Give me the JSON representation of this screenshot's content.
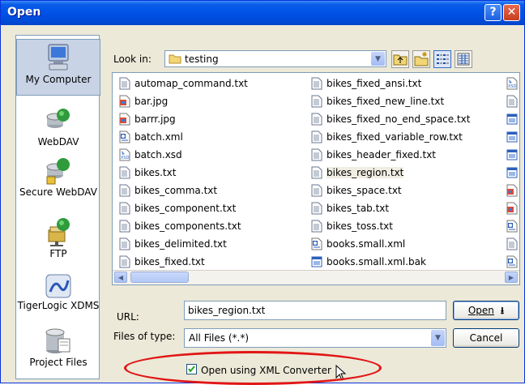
{
  "window": {
    "title": "Open"
  },
  "places": [
    {
      "label": "My Computer",
      "icon": "my-computer-icon",
      "selected": true
    },
    {
      "label": "WebDAV",
      "icon": "webdav-icon"
    },
    {
      "label": "Secure WebDAV",
      "icon": "secure-webdav-icon"
    },
    {
      "label": "FTP",
      "icon": "ftp-icon"
    },
    {
      "label": "TigerLogic XDMS",
      "icon": "tigerlogic-xdms-icon"
    },
    {
      "label": "Project Files",
      "icon": "project-files-icon"
    }
  ],
  "look_in": {
    "label": "Look in:",
    "value": "testing"
  },
  "files": {
    "col1": [
      {
        "name": "automap_command.txt",
        "type": "txt"
      },
      {
        "name": "bar.jpg",
        "type": "jpg"
      },
      {
        "name": "barrr.jpg",
        "type": "jpg"
      },
      {
        "name": "batch.xml",
        "type": "xml"
      },
      {
        "name": "batch.xsd",
        "type": "xsd"
      },
      {
        "name": "bikes.txt",
        "type": "txt"
      },
      {
        "name": "bikes_comma.txt",
        "type": "txt"
      },
      {
        "name": "bikes_component.txt",
        "type": "txt"
      },
      {
        "name": "bikes_components.txt",
        "type": "txt"
      },
      {
        "name": "bikes_delimited.txt",
        "type": "txt"
      },
      {
        "name": "bikes_fixed.txt",
        "type": "txt"
      }
    ],
    "col2": [
      {
        "name": "bikes_fixed_ansi.txt",
        "type": "txt"
      },
      {
        "name": "bikes_fixed_new_line.txt",
        "type": "txt"
      },
      {
        "name": "bikes_fixed_no_end_space.txt",
        "type": "txt"
      },
      {
        "name": "bikes_fixed_variable_row.txt",
        "type": "txt"
      },
      {
        "name": "bikes_header_fixed.txt",
        "type": "txt"
      },
      {
        "name": "bikes_region.txt",
        "type": "txt",
        "highlighted": true
      },
      {
        "name": "bikes_space.txt",
        "type": "txt"
      },
      {
        "name": "bikes_tab.txt",
        "type": "txt"
      },
      {
        "name": "bikes_toss.txt",
        "type": "txt"
      },
      {
        "name": "books.small.xml",
        "type": "xml"
      },
      {
        "name": "books.small.xml.bak",
        "type": "bak"
      }
    ]
  },
  "url": {
    "label": "URL:",
    "value": "bikes_region.txt"
  },
  "files_of_type": {
    "label": "Files of type:",
    "value": "All Files (*.*)"
  },
  "buttons": {
    "open": "Open",
    "cancel": "Cancel"
  },
  "checkbox": {
    "label": "Open using XML Converter",
    "checked": true
  },
  "colors": {
    "titlebar": "#0052e6",
    "highlight_ellipse": "#e21515",
    "dialog_bg": "#ece9d8"
  }
}
